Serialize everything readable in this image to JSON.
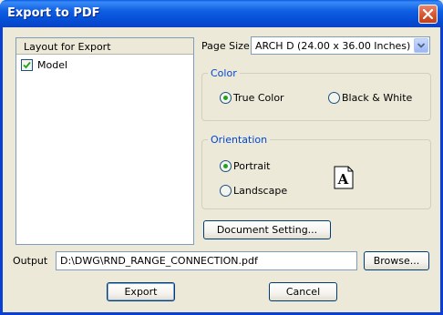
{
  "window": {
    "title": "Export to PDF"
  },
  "layout_list": {
    "header": "Layout for Export",
    "items": [
      {
        "label": "Model",
        "checked": true
      }
    ]
  },
  "page_size": {
    "label": "Page Size",
    "value": "ARCH D (24.00 x 36.00 Inches)"
  },
  "color_group": {
    "title": "Color",
    "options": [
      {
        "label": "True Color",
        "selected": true
      },
      {
        "label": "Black & White",
        "selected": false
      }
    ]
  },
  "orientation_group": {
    "title": "Orientation",
    "options": [
      {
        "label": "Portrait",
        "selected": true
      },
      {
        "label": "Landscape",
        "selected": false
      }
    ],
    "preview_letter": "A"
  },
  "document_setting_button": "Document Setting...",
  "output": {
    "label": "Output",
    "value": "D:\\DWG\\RND_RANGE_CONNECTION.pdf",
    "browse_label": "Browse..."
  },
  "footer": {
    "export_label": "Export",
    "cancel_label": "Cancel"
  },
  "colors": {
    "titlebar": "#0a5ee8",
    "group_title": "#0046d5",
    "radio_dot": "#21a121",
    "check_mark": "#21a121",
    "close_button": "#d85a37"
  }
}
